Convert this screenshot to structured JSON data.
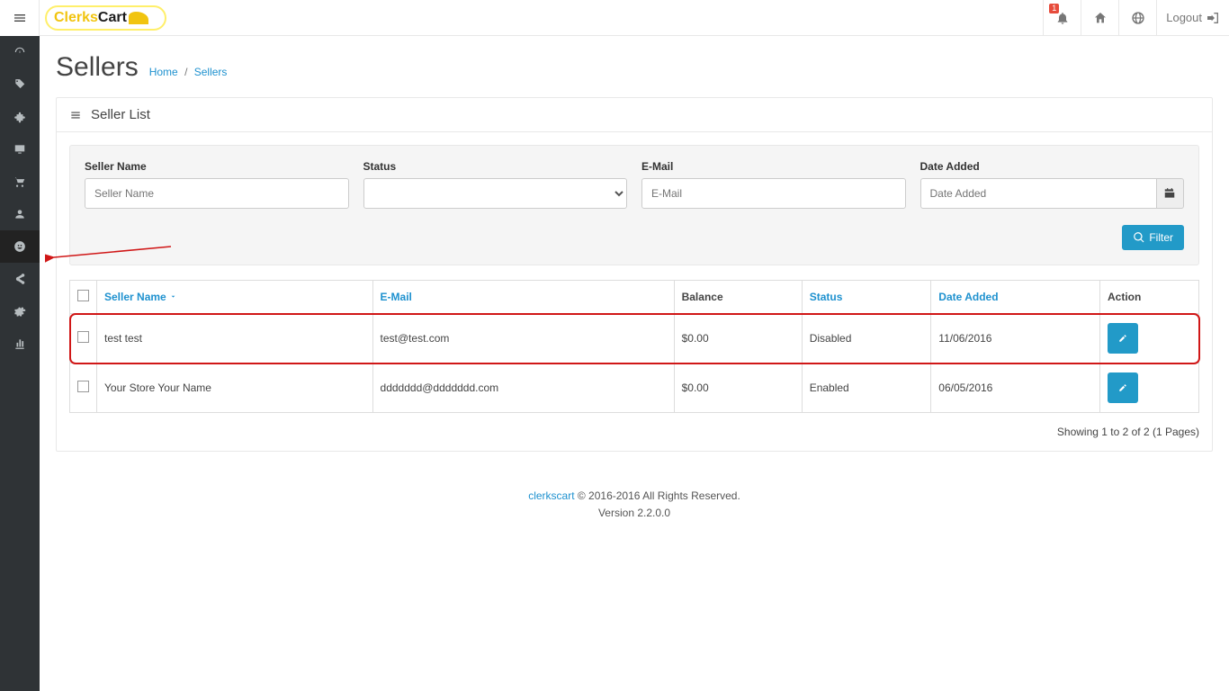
{
  "header": {
    "logo_part1": "Clerks",
    "logo_part2": "Cart",
    "notif_badge": "1",
    "logout_label": "Logout"
  },
  "page": {
    "title": "Sellers",
    "breadcrumb_home": "Home",
    "breadcrumb_current": "Sellers"
  },
  "panel": {
    "heading": "Seller List"
  },
  "filters": {
    "seller_name_label": "Seller Name",
    "seller_name_placeholder": "Seller Name",
    "status_label": "Status",
    "email_label": "E-Mail",
    "email_placeholder": "E-Mail",
    "date_label": "Date Added",
    "date_placeholder": "Date Added",
    "filter_btn": "Filter"
  },
  "table": {
    "headers": {
      "seller_name": "Seller Name",
      "email": "E-Mail",
      "balance": "Balance",
      "status": "Status",
      "date_added": "Date Added",
      "action": "Action"
    },
    "rows": [
      {
        "name": "test test",
        "email": "test@test.com",
        "balance": "$0.00",
        "status": "Disabled",
        "date": "11/06/2016",
        "highlight": true
      },
      {
        "name": "Your Store Your Name",
        "email": "ddddddd@ddddddd.com",
        "balance": "$0.00",
        "status": "Enabled",
        "date": "06/05/2016",
        "highlight": false
      }
    ]
  },
  "pagination": "Showing 1 to 2 of 2 (1 Pages)",
  "footer": {
    "brand": "clerkscart",
    "copy": " © 2016-2016 All Rights Reserved.",
    "version": "Version 2.2.0.0"
  }
}
